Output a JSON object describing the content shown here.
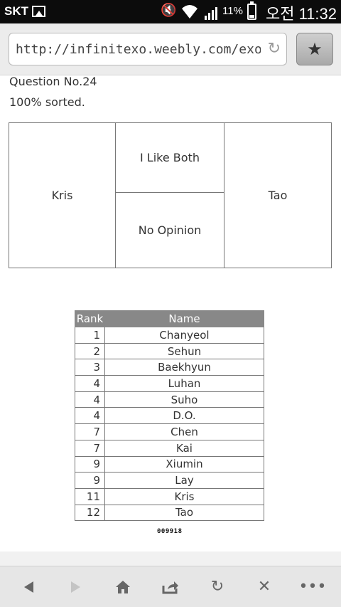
{
  "status_bar": {
    "carrier": "SKT",
    "battery_percent": "11%",
    "time": "오전 11:32"
  },
  "browser": {
    "url": "http://infinitexo.weebly.com/exo.h"
  },
  "page": {
    "question": "Question No.24",
    "progress": "100% sorted.",
    "choices": {
      "left": "Kris",
      "both": "I Like Both",
      "none": "No Opinion",
      "right": "Tao"
    },
    "table": {
      "headers": [
        "Rank",
        "Name"
      ],
      "rows": [
        {
          "rank": "1",
          "name": "Chanyeol"
        },
        {
          "rank": "2",
          "name": "Sehun"
        },
        {
          "rank": "3",
          "name": "Baekhyun"
        },
        {
          "rank": "4",
          "name": "Luhan"
        },
        {
          "rank": "4",
          "name": "Suho"
        },
        {
          "rank": "4",
          "name": "D.O."
        },
        {
          "rank": "7",
          "name": "Chen"
        },
        {
          "rank": "7",
          "name": "Kai"
        },
        {
          "rank": "9",
          "name": "Xiumin"
        },
        {
          "rank": "9",
          "name": "Lay"
        },
        {
          "rank": "11",
          "name": "Kris"
        },
        {
          "rank": "12",
          "name": "Tao"
        }
      ]
    },
    "counter": "009918"
  },
  "icons": {
    "refresh": "refresh-icon",
    "bookmark": "star-icon",
    "back": "back-arrow-icon",
    "forward": "forward-arrow-icon",
    "home": "home-icon",
    "share": "share-icon",
    "reload": "reload-icon",
    "close": "close-icon",
    "menu": "more-icon"
  }
}
